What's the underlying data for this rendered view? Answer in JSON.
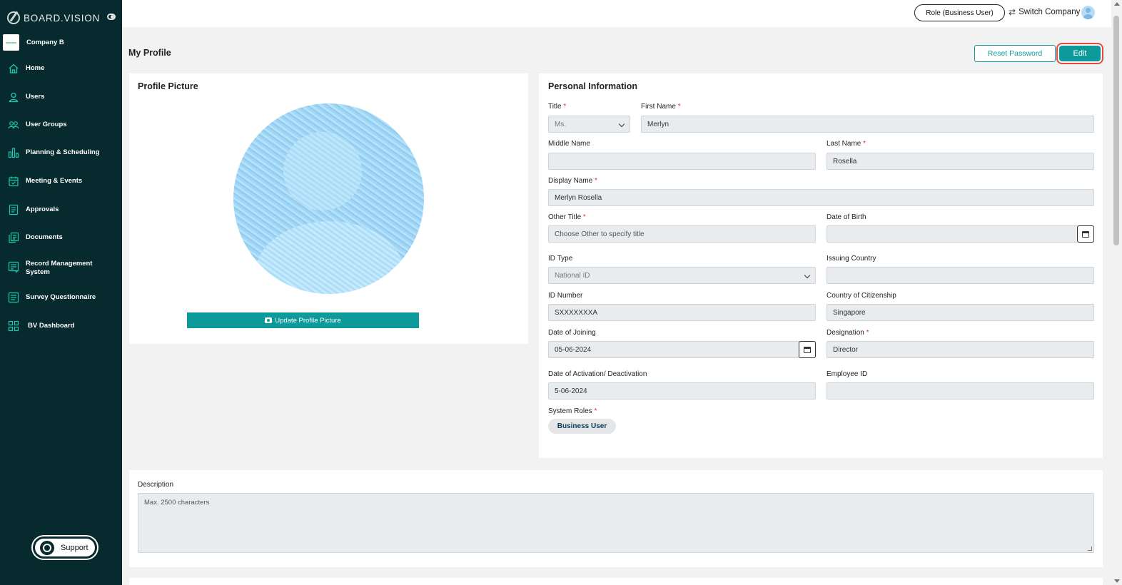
{
  "app": {
    "brand": "BOARD.VISION",
    "company": "Company B"
  },
  "sidebar": {
    "items": [
      {
        "label": "Home",
        "icon": "home-icon"
      },
      {
        "label": "Users",
        "icon": "user-icon"
      },
      {
        "label": "User Groups",
        "icon": "user-groups-icon"
      },
      {
        "label": "Planning & Scheduling",
        "icon": "bar-chart-icon"
      },
      {
        "label": "Meeting & Events",
        "icon": "calendar-check-icon"
      },
      {
        "label": "Approvals",
        "icon": "approval-doc-icon"
      },
      {
        "label": "Documents",
        "icon": "documents-icon"
      },
      {
        "label": "Record Management System",
        "icon": "records-icon"
      },
      {
        "label": "Survey Questionnaire",
        "icon": "survey-icon"
      },
      {
        "label": "BV Dashboard",
        "icon": "dashboard-grid-icon"
      }
    ],
    "support_label": "Support"
  },
  "topbar": {
    "role": "Role (Business User)",
    "switch_company": "Switch Company"
  },
  "page": {
    "title": "My Profile",
    "reset_password": "Reset Password",
    "edit": "Edit"
  },
  "profile_picture": {
    "title": "Profile Picture",
    "update_button": "Update Profile Picture"
  },
  "personal_info": {
    "title": "Personal Information",
    "title_label": "Title",
    "title_value": "Ms.",
    "first_name_label": "First Name",
    "first_name": "Merlyn",
    "middle_name_label": "Middle Name",
    "middle_name": "",
    "last_name_label": "Last Name",
    "last_name": "Rosella",
    "display_name_label": "Display Name",
    "display_name": "Merlyn Rosella",
    "other_title_label": "Other Title",
    "other_title_placeholder": "Choose Other to specify title",
    "dob_label": "Date of Birth",
    "dob": "",
    "id_type_label": "ID Type",
    "id_type": "National ID",
    "issuing_country_label": "Issuing Country",
    "issuing_country": "",
    "id_number_label": "ID Number",
    "id_number": "SXXXXXXXA",
    "citizenship_label": "Country of Citizenship",
    "citizenship": "Singapore",
    "joining_label": "Date of Joining",
    "joining": "05-06-2024",
    "designation_label": "Designation",
    "designation": "Director",
    "activation_label": "Date of Activation/ Deactivation",
    "activation": "5-06-2024",
    "employee_id_label": "Employee ID",
    "employee_id": "",
    "system_roles_label": "System Roles",
    "system_role": "Business User"
  },
  "description": {
    "label": "Description",
    "placeholder": "Max. 2500 characters"
  },
  "colors": {
    "sidebar": "#062a2e",
    "accent": "#0e9a9a",
    "highlight": "#e54b3c"
  }
}
